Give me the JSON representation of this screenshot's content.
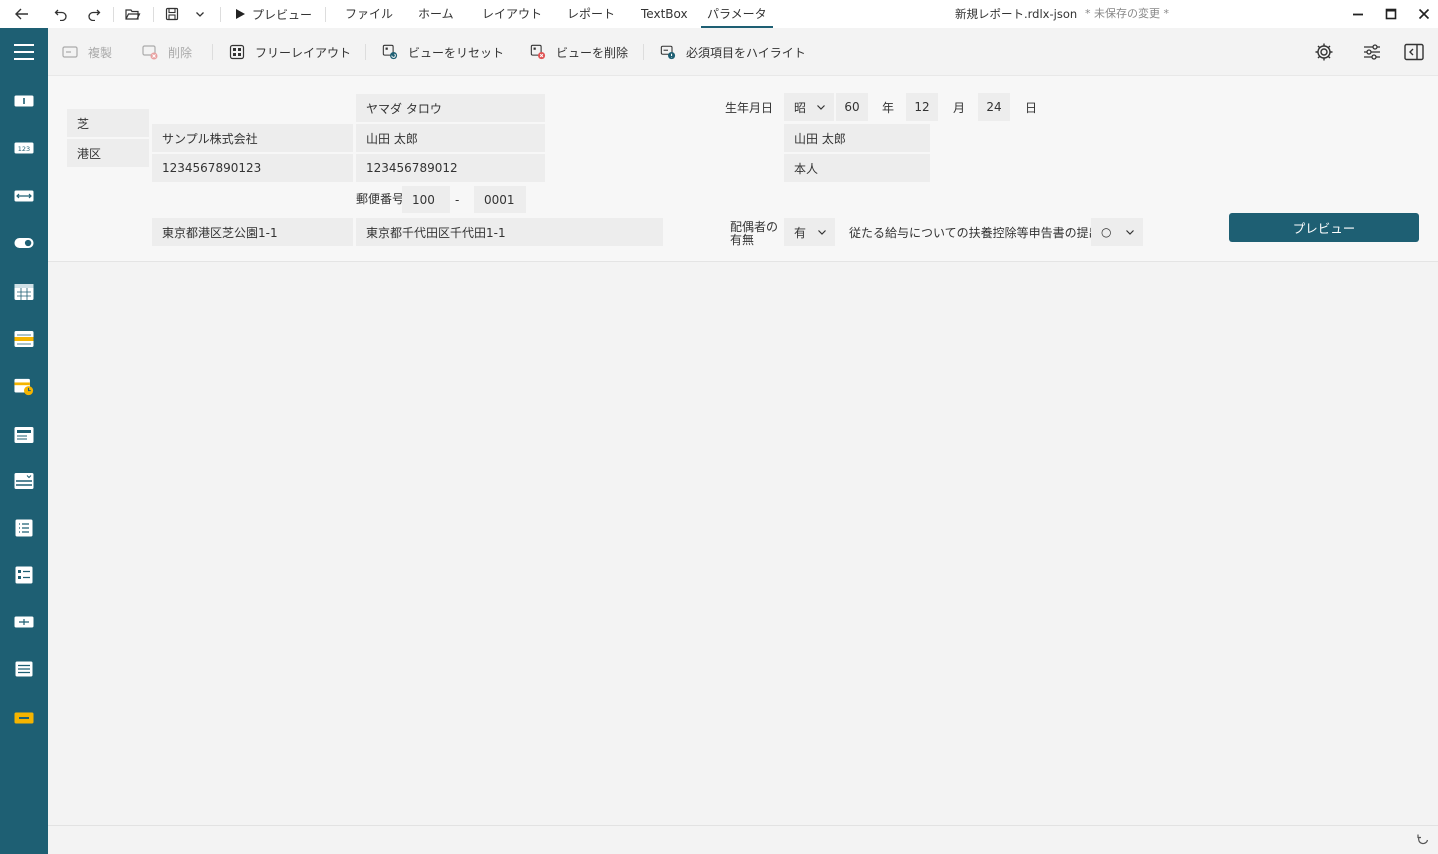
{
  "titlebar": {
    "preview_label": "プレビュー",
    "menu": [
      "ファイル",
      "ホーム",
      "レイアウト",
      "レポート",
      "TextBox",
      "パラメータ"
    ],
    "active_menu": "パラメータ",
    "doc_title": "新規レポート.rdlx-json",
    "doc_status": "* 未保存の変更 *"
  },
  "toolbar": {
    "duplicate": "複製",
    "delete": "削除",
    "free_layout": "フリーレイアウト",
    "reset_view": "ビューをリセット",
    "delete_view": "ビューを削除",
    "highlight_required": "必須項目をハイライト"
  },
  "form": {
    "kana_name": "ヤマダ タロウ",
    "left_area_1": "芝",
    "left_area_2": "港区",
    "company": "サンプル株式会社",
    "name": "山田 太郎",
    "number_13": "1234567890123",
    "number_12": "123456789012",
    "postal_label": "郵便番号",
    "postal_1": "100",
    "postal_dash": "-",
    "postal_2": "0001",
    "address_1": "東京都港区芝公園1-1",
    "address_2": "東京都千代田区千代田1-1",
    "birth_label": "生年月日",
    "era": "昭",
    "year": "60",
    "year_unit": "年",
    "month": "12",
    "month_unit": "月",
    "day": "24",
    "day_unit": "日",
    "name_right": "山田 太郎",
    "relation": "本人",
    "spouse_label_1": "配偶者の",
    "spouse_label_2": "有無",
    "spouse_value": "有",
    "submission_label": "従たる給与についての扶養控除等申告書の提出",
    "submission_value": "○",
    "preview_button": "プレビュー"
  },
  "colors": {
    "accent": "#1e5f73",
    "field_bg": "#ededed",
    "required_icon": "#e05555",
    "warning_icon": "#f5b400"
  }
}
